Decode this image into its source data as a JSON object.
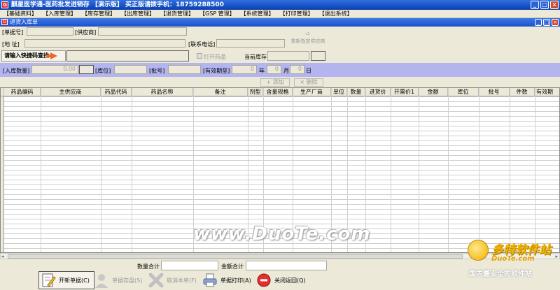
{
  "window": {
    "title": "麒星医学通-医药批发进销存 【演示版】 买正版请拨手机：18759288500",
    "app_icon": "app-logo-icon",
    "buttons": {
      "minimize": "_",
      "maximize": "□",
      "close": "×"
    }
  },
  "menu": [
    "【基础资料】",
    "【入库管理】",
    "【库存管理】",
    "【出库管理】",
    "【退货管理】",
    "【GSP 管理】",
    "【系统管理】",
    "【打印管理】",
    "【退出系统】"
  ],
  "child_window": {
    "title": "进货入库单",
    "buttons": {
      "minimize": "_",
      "maximize": "□",
      "close": "×"
    }
  },
  "form": {
    "bill_no_label": "[单据号]",
    "supplier_label": "[供应商]",
    "address_label": "[地  址]",
    "phone_label": "[联系电话]",
    "refresh_label": "重新指定供应商",
    "quick_search_label": "请输入快捷码查找",
    "open_drug_label": "打开药品",
    "current_stock_label": "当前库存"
  },
  "entry": {
    "qty_label": "[入库数量]",
    "qty_value": "0.00",
    "location_label": "[库位]",
    "batch_label": "[批号]",
    "expiry_label": "[有效期至]",
    "year_value": "0",
    "year_unit": "年",
    "month_value": "0",
    "month_unit": "月",
    "day_value": "0",
    "day_unit": "日"
  },
  "toolbar": {
    "add_label": "+ 添加",
    "delete_label": "× 删除"
  },
  "grid": {
    "columns": [
      "药品编码",
      "主供应商",
      "药品代码",
      "药品名称",
      "备注",
      "剂型",
      "含量规格",
      "生产厂商",
      "单位",
      "数量",
      "进货价",
      "开票价1",
      "金额",
      "库位",
      "批号",
      "件数",
      "有效期"
    ]
  },
  "watermark": "www.DuoTe.com",
  "summary": {
    "qty_total_label": "数量合计",
    "amount_total_label": "金额合计"
  },
  "actions": {
    "new_bill": "开新单据(C)",
    "save_bill": "单据存盘(S)",
    "cancel_bill": "取消本单(F)",
    "print_bill": "单据打印(A)",
    "close_return": "关闭返回(Q)"
  },
  "site_logo": {
    "name": "多特软件站",
    "url": "DuoTe.com",
    "tagline": "国内最安全的软件站"
  },
  "colors": {
    "title_bar": "#0a3fb0",
    "entry_bar": "#b4b4ee",
    "arrow": "#e8692a",
    "close_button": "#d64a2c"
  }
}
